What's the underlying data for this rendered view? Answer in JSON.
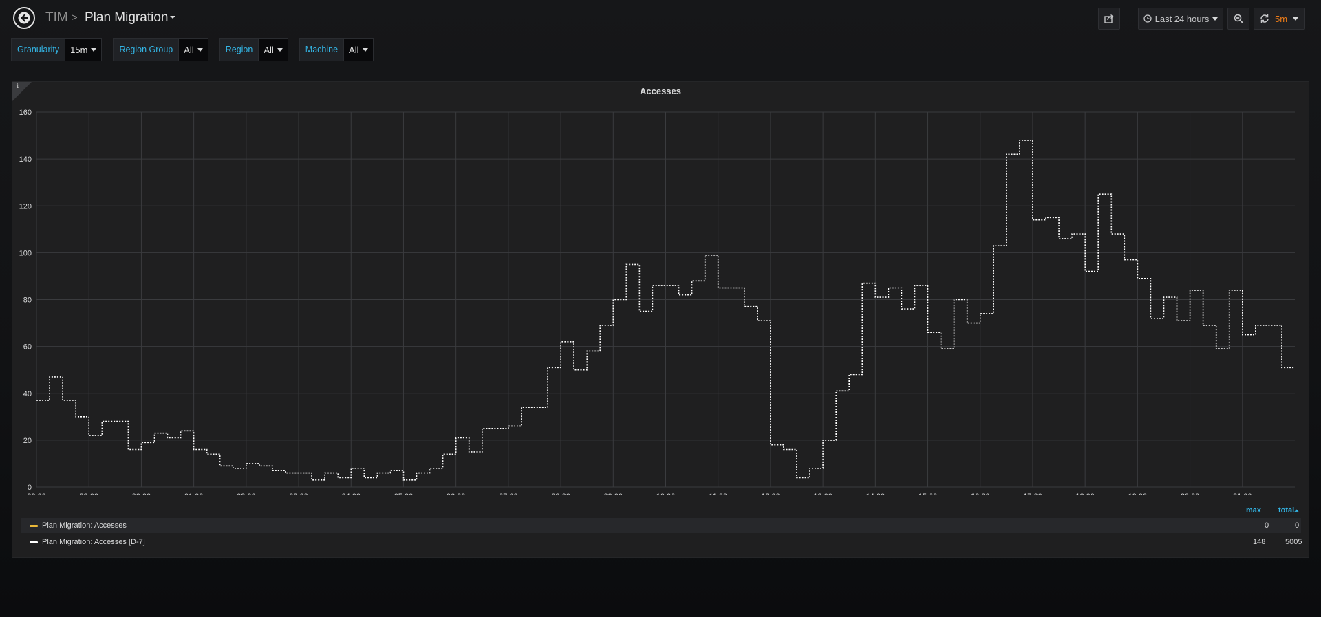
{
  "breadcrumb": {
    "folder": "TIM",
    "separator": ">",
    "title": "Plan Migration"
  },
  "toolbar": {
    "time_range": "Last 24 hours",
    "refresh_interval": "5m"
  },
  "variables": [
    {
      "label": "Granularity",
      "value": "15m"
    },
    {
      "label": "Region Group",
      "value": "All"
    },
    {
      "label": "Region",
      "value": "All"
    },
    {
      "label": "Machine",
      "value": "All"
    }
  ],
  "panel": {
    "info_glyph": "i",
    "title": "Accesses"
  },
  "legend": {
    "columns": [
      "max",
      "total"
    ],
    "sort_indicator": "⏶",
    "rows": [
      {
        "name": "Plan Migration: Accesses",
        "color": "#eab839",
        "max": "0",
        "total": "0"
      },
      {
        "name": "Plan Migration: Accesses [D-7]",
        "color": "#ffffff",
        "max": "148",
        "total": "5005"
      }
    ]
  },
  "colors": {
    "accent": "#33b5e5",
    "refresh": "#eb7b18",
    "series_d7": "#ffffff",
    "series_main": "#eab839"
  },
  "chart_data": {
    "type": "line",
    "title": "Accesses",
    "xlabel": "",
    "ylabel": "",
    "x_ticks": [
      "22:00",
      "23:00",
      "00:00",
      "01:00",
      "02:00",
      "03:00",
      "04:00",
      "05:00",
      "06:00",
      "07:00",
      "08:00",
      "09:00",
      "10:00",
      "11:00",
      "12:00",
      "13:00",
      "14:00",
      "15:00",
      "16:00",
      "17:00",
      "18:00",
      "19:00",
      "20:00",
      "21:00"
    ],
    "y_ticks": [
      "0",
      "20",
      "40",
      "60",
      "80",
      "100",
      "120",
      "140",
      "160"
    ],
    "ylim": [
      0,
      160
    ],
    "xlim_hours_from_22_00": [
      0,
      24
    ],
    "interpolation": "step",
    "grid": true,
    "legend_placement": "bottom",
    "series": [
      {
        "name": "Plan Migration: Accesses [D-7]",
        "style": "dotted",
        "x_start": "22:00",
        "step_minutes": 15,
        "values": [
          37,
          47,
          37,
          30,
          22,
          28,
          28,
          16,
          19,
          23,
          21,
          24,
          16,
          14,
          9,
          8,
          10,
          9,
          7,
          6,
          6,
          3,
          6,
          4,
          8,
          4,
          6,
          7,
          3,
          6,
          8,
          14,
          21,
          15,
          25,
          25,
          26,
          34,
          34,
          51,
          62,
          50,
          58,
          69,
          80,
          95,
          75,
          86,
          86,
          82,
          88,
          99,
          85,
          85,
          77,
          71,
          18,
          16,
          4,
          8,
          20,
          41,
          48,
          87,
          81,
          85,
          76,
          86,
          66,
          59,
          80,
          70,
          74,
          103,
          142,
          148,
          114,
          115,
          106,
          108,
          92,
          125,
          108,
          97,
          89,
          72,
          81,
          71,
          84,
          69,
          59,
          84,
          65,
          69,
          69,
          51
        ]
      },
      {
        "name": "Plan Migration: Accesses",
        "style": "solid",
        "values": []
      }
    ]
  }
}
